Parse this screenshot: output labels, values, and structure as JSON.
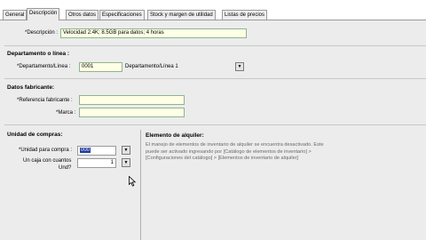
{
  "tabs": [
    {
      "label": "General"
    },
    {
      "label": "Descripción"
    },
    {
      "label": "Otros datos"
    },
    {
      "label": "Especificaciones"
    },
    {
      "label": "Stock y margen de utilidad"
    },
    {
      "label": "Listas de precios"
    }
  ],
  "description": {
    "label": "*Descripción :",
    "value": "Velocidad 2.4K; 8.5GB para datos; 4 horas"
  },
  "department": {
    "title": "Departamento o línea :",
    "label": "*Departamento/Línea :",
    "code": "0001",
    "name": "Departamento/Línea 1"
  },
  "manufacturer": {
    "title": "Datos fabricante:",
    "reference_label": "*Referencia fabricante :",
    "reference_value": "",
    "brand_label": "*Marca :",
    "brand_value": ""
  },
  "purchase_unit": {
    "title": "Unidad de compras:",
    "unit_label": "*Unidad para compra :",
    "unit_value": "000",
    "box_label_1": "Un caja con cuantos",
    "box_label_2": "Und?",
    "box_value": "1"
  },
  "rental": {
    "title": "Elemento de alquiler:",
    "text": "El manejo de elementos de inventario de alquiler se encuentra desactivado. Este puede ser activado ingresando por [Catálogo de elementos de inventario] > [Configuraciones del catálogo] > [Elementos de inventario de alquiler]"
  },
  "icons": {
    "dropdown": "dropdown-arrow-icon",
    "cursor": "mouse-pointer-icon"
  },
  "colors": {
    "panel": "#ececec",
    "required_field": "#ffffe6",
    "selection": "#1f3a9a"
  }
}
